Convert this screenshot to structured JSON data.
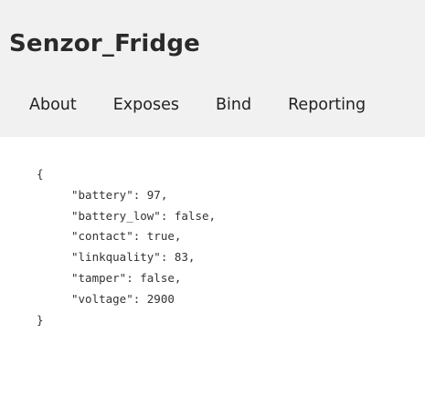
{
  "device": {
    "title": "Senzor_Fridge"
  },
  "tabs": [
    {
      "label": "About"
    },
    {
      "label": "Exposes"
    },
    {
      "label": "Bind"
    },
    {
      "label": "Reporting"
    }
  ],
  "state_json": {
    "open_brace": "{",
    "lines": [
      "\"battery\": 97,",
      "\"battery_low\": false,",
      "\"contact\": true,",
      "\"linkquality\": 83,",
      "\"tamper\": false,",
      "\"voltage\": 2900"
    ],
    "close_brace": "}"
  }
}
